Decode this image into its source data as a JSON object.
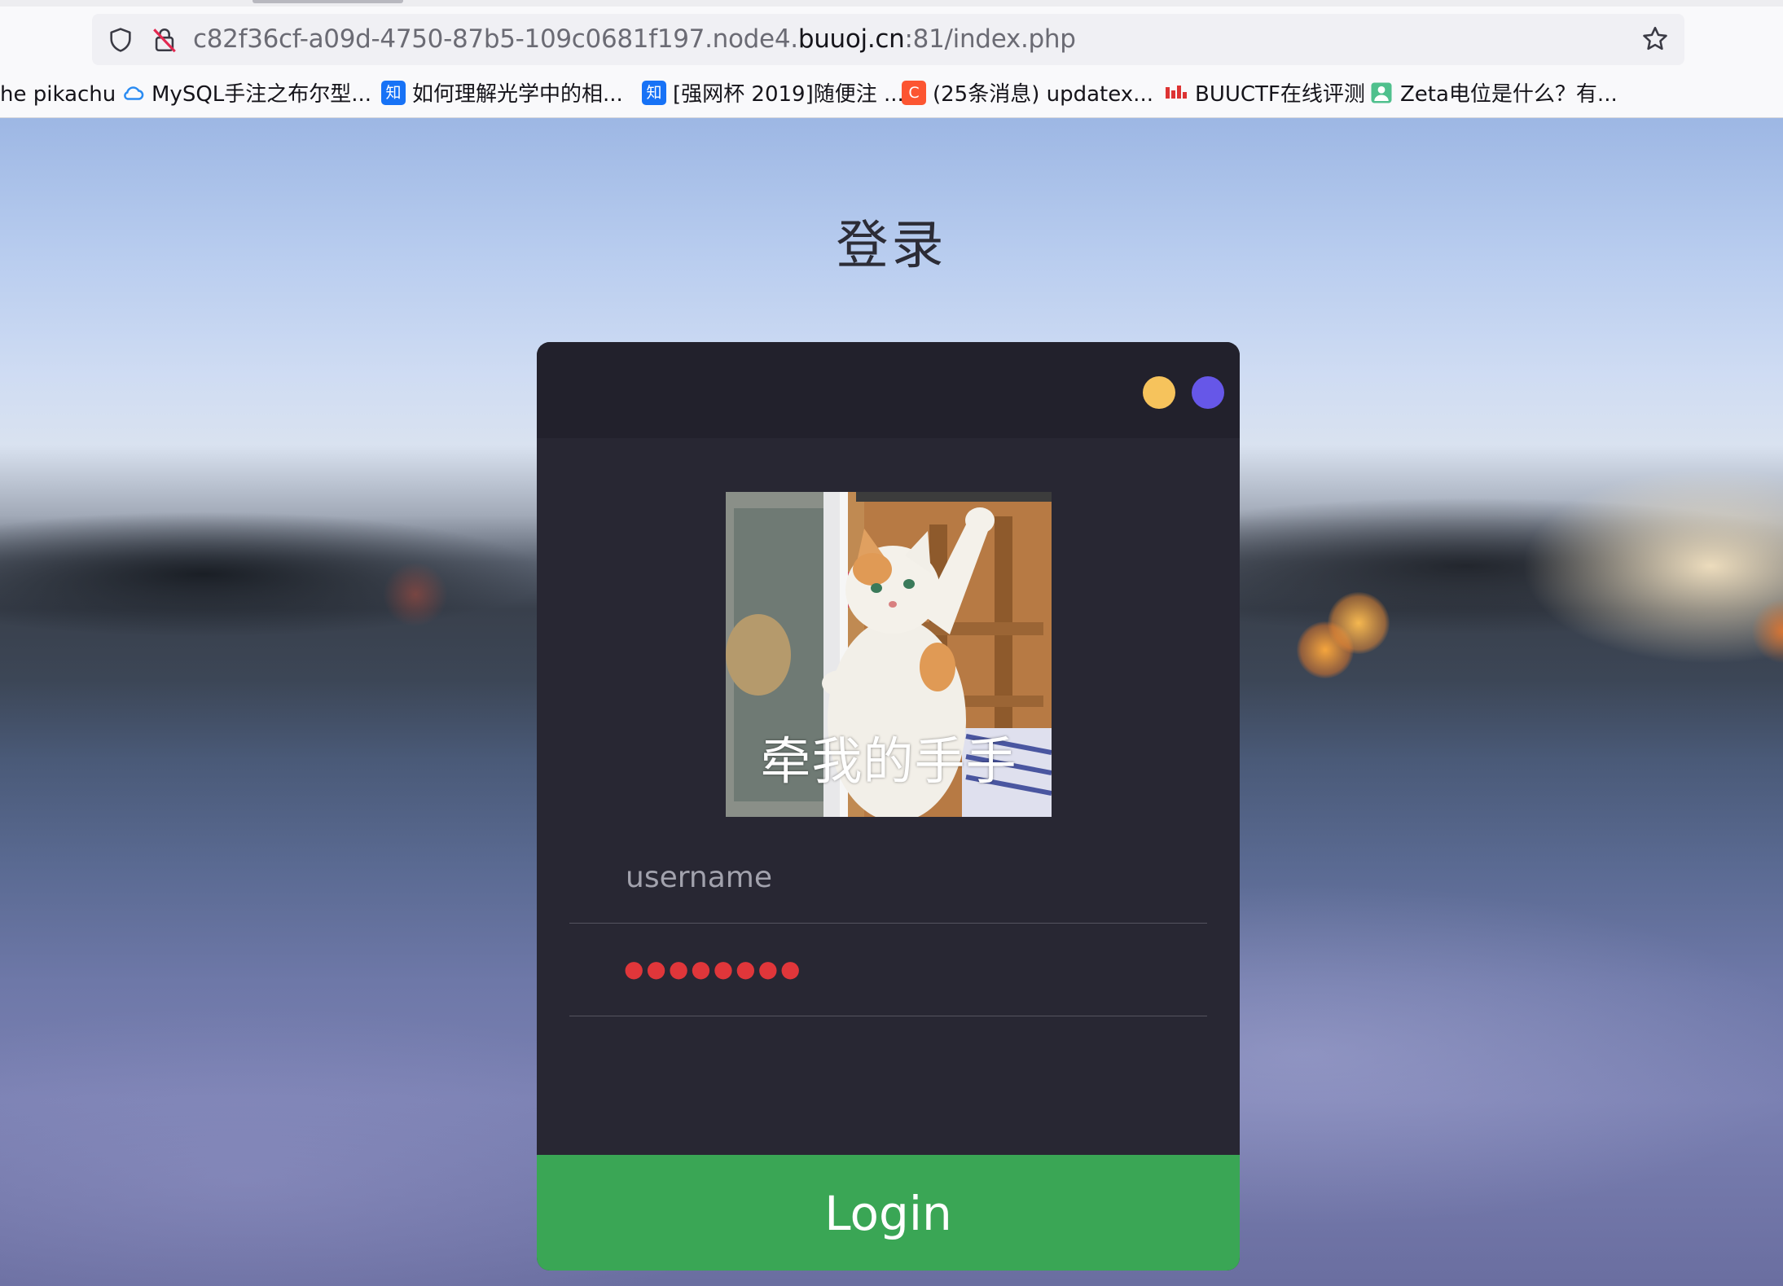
{
  "browser": {
    "url_prefix": "c82f36cf-a09d-4750-87b5-109c0681f197.node4.",
    "url_domain": "buuoj.cn",
    "url_suffix": ":81/index.php",
    "icons": {
      "tracking": "shield-icon",
      "security": "insecure-lock-icon",
      "bookmark": "star-icon"
    },
    "bookmarks": [
      {
        "label": "he pikachu",
        "icon": "none"
      },
      {
        "label": "MySQL手注之布尔型...",
        "icon": "cloud-icon"
      },
      {
        "label": "如何理解光学中的相...",
        "icon": "zhihu-icon",
        "icon_text": "知"
      },
      {
        "label": "[强网杯 2019]随便注 ...",
        "icon": "zhihu-icon",
        "icon_text": "知"
      },
      {
        "label": "(25条消息) updatex...",
        "icon": "csdn-icon",
        "icon_text": "C"
      },
      {
        "label": "BUUCTF在线评测",
        "icon": "buu-icon"
      },
      {
        "label": "Zeta电位是什么？有...",
        "icon": "person-icon"
      }
    ]
  },
  "page": {
    "title": "登录"
  },
  "login": {
    "window_dots": [
      "#f6c35c",
      "#6657e8"
    ],
    "avatar_caption": "牵我的手手",
    "username_placeholder": "username",
    "password_masked": "●●●●●●●●",
    "password_mask_color": "#e0363a",
    "button_label": "Login",
    "button_color": "#3aa655"
  }
}
